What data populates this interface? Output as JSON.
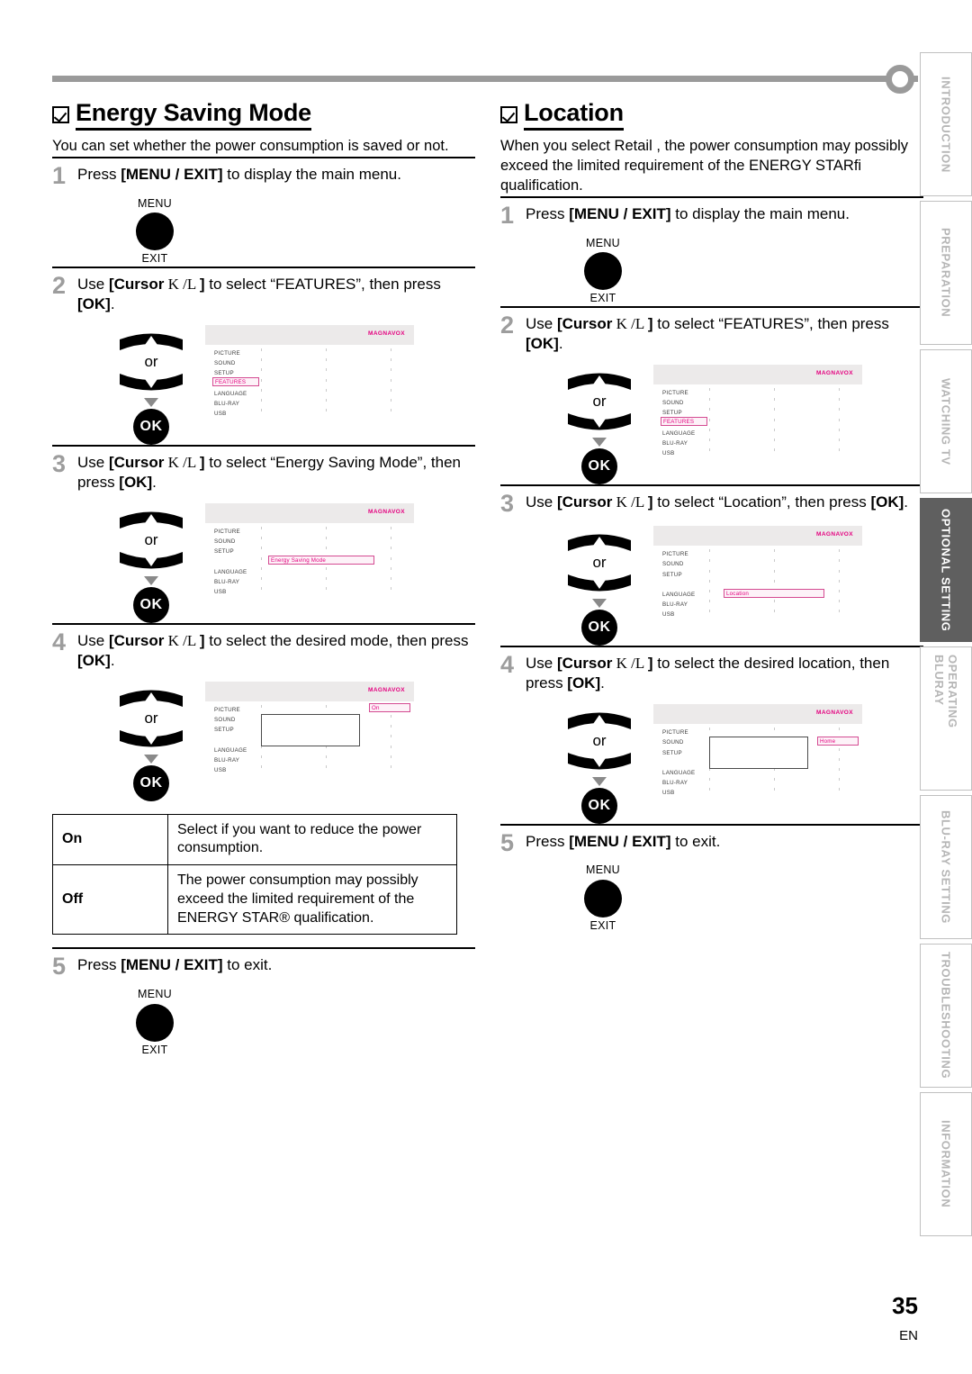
{
  "page": {
    "number": "35",
    "lang_code": "EN"
  },
  "sections": [
    {
      "id": "energy-saving-mode",
      "title": "Energy Saving Mode",
      "desc": "You can set whether the power consumption is saved or not.",
      "steps": [
        {
          "num": "1",
          "text_parts": [
            "Press ",
            "[MENU / EXIT]",
            " to display the main menu."
          ],
          "graphic": "menu-button"
        },
        {
          "num": "2",
          "text_parts": [
            "Use ",
            "[Cursor",
            " K /L ",
            "]",
            " to select “FEATURES”, then press ",
            "[OK]",
            "."
          ],
          "graphic": "cursor-ok-tv",
          "tv": {
            "brand": "MAGNAVOX",
            "items": [
              "PICTURE",
              "SOUND",
              "SETUP",
              "FEATURES",
              "LANGUAGE",
              "BLU-RAY",
              "USB"
            ],
            "highlight": {
              "label": "FEATURES",
              "index": 3,
              "style": "inline"
            }
          }
        },
        {
          "num": "3",
          "text_parts": [
            "Use ",
            "[Cursor",
            " K /L ",
            "]",
            " to select “Energy Saving Mode”, then press ",
            "[OK]",
            "."
          ],
          "graphic": "cursor-ok-tv",
          "tv": {
            "brand": "MAGNAVOX",
            "items": [
              "PICTURE",
              "SOUND",
              "SETUP",
              "",
              "LANGUAGE",
              "BLU-RAY",
              "USB"
            ],
            "highlight": {
              "label": "Energy Saving Mode",
              "index": 3,
              "style": "submenu"
            }
          }
        },
        {
          "num": "4",
          "text_parts": [
            "Use ",
            "[Cursor",
            " K /L ",
            "]",
            " to select the desired mode, then press ",
            "[OK]",
            "."
          ],
          "graphic": "cursor-ok-tv",
          "tv": {
            "brand": "MAGNAVOX",
            "items": [
              "PICTURE",
              "SOUND",
              "SETUP",
              "",
              "LANGUAGE",
              "BLU-RAY",
              "USB"
            ],
            "highlight": {
              "label": "On",
              "index": 0,
              "style": "value"
            },
            "empty_box": true
          }
        },
        {
          "num": "5",
          "text_parts": [
            "Press ",
            "[MENU / EXIT]",
            " to exit."
          ],
          "graphic": "menu-button"
        }
      ],
      "table": {
        "rows": [
          {
            "key": "On",
            "value": "Select if you want to reduce the power consumption."
          },
          {
            "key": "Off",
            "value": "The power consumption may possibly exceed the limited requirement of the ENERGY STAR® qualification."
          }
        ]
      }
    },
    {
      "id": "location",
      "title": "Location",
      "desc": "When you select  Retail , the power consumption may possibly exceed the limited requirement of the ENERGY STARfi qualification.",
      "steps": [
        {
          "num": "1",
          "text_parts": [
            "Press ",
            "[MENU / EXIT]",
            " to display the main menu."
          ],
          "graphic": "menu-button"
        },
        {
          "num": "2",
          "text_parts": [
            "Use ",
            "[Cursor",
            " K /L ",
            "]",
            " to select “FEATURES”, then press ",
            "[OK]",
            "."
          ],
          "graphic": "cursor-ok-tv",
          "tv": {
            "brand": "MAGNAVOX",
            "items": [
              "PICTURE",
              "SOUND",
              "SETUP",
              "FEATURES",
              "LANGUAGE",
              "BLU-RAY",
              "USB"
            ],
            "highlight": {
              "label": "FEATURES",
              "index": 3,
              "style": "inline"
            }
          }
        },
        {
          "num": "3",
          "text_parts": [
            "Use ",
            "[Cursor",
            " K /L ",
            "]",
            " to select “Location”, then press ",
            "[OK]",
            "."
          ],
          "graphic": "cursor-ok-tv",
          "tv": {
            "brand": "MAGNAVOX",
            "items": [
              "PICTURE",
              "SOUND",
              "SETUP",
              "",
              "LANGUAGE",
              "BLU-RAY",
              "USB"
            ],
            "highlight": {
              "label": "Location",
              "index": 4,
              "style": "submenu"
            }
          }
        },
        {
          "num": "4",
          "text_parts": [
            "Use ",
            "[Cursor",
            " K /L ",
            "]",
            " to select the desired location, then press ",
            "[OK]",
            "."
          ],
          "graphic": "cursor-ok-tv",
          "tv": {
            "brand": "MAGNAVOX",
            "items": [
              "PICTURE",
              "SOUND",
              "SETUP",
              "",
              "LANGUAGE",
              "BLU-RAY",
              "USB"
            ],
            "highlight": {
              "label": "Home",
              "index": 1,
              "style": "value"
            },
            "empty_box": true
          }
        },
        {
          "num": "5",
          "text_parts": [
            "Press ",
            "[MENU / EXIT]",
            " to exit."
          ],
          "graphic": "menu-button"
        }
      ]
    }
  ],
  "remote_labels": {
    "menu": "MENU",
    "exit": "EXIT",
    "ok": "OK",
    "or": "or"
  },
  "side_tabs": [
    {
      "label": "INTRODUCTION",
      "active": false
    },
    {
      "label": "PREPARATION",
      "active": false
    },
    {
      "label": "WATCHING TV",
      "active": false
    },
    {
      "label": "OPTIONAL SETTING",
      "active": true
    },
    {
      "label": "OPERATING BLURAY",
      "active": false
    },
    {
      "label": "BLU-RAY SETTING",
      "active": false
    },
    {
      "label": "TROUBLESHOOTING",
      "active": false
    },
    {
      "label": "INFORMATION",
      "active": false
    }
  ],
  "colors": {
    "accent_pink": "#e4007f",
    "tab_active_bg": "#5f5f5f",
    "rule_gray": "#9a9a9a"
  }
}
